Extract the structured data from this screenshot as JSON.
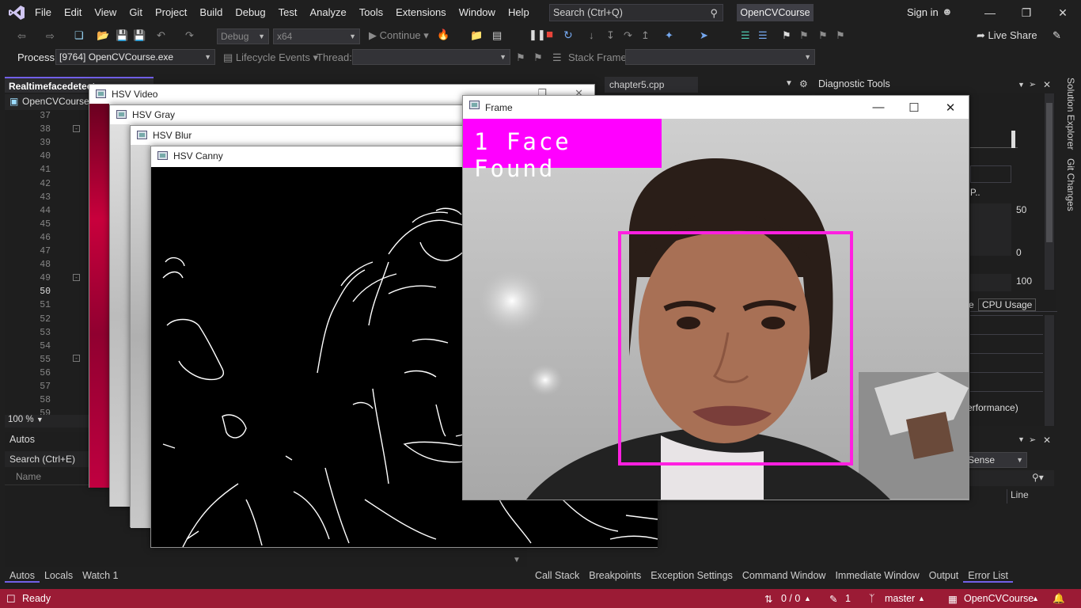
{
  "menubar": {
    "items": [
      "File",
      "Edit",
      "View",
      "Git",
      "Project",
      "Build",
      "Debug",
      "Test",
      "Analyze",
      "Tools",
      "Extensions",
      "Window",
      "Help"
    ],
    "search_placeholder": "Search (Ctrl+Q)",
    "solution_name": "OpenCVCourse",
    "sign_in": "Sign in"
  },
  "toolbar": {
    "config": "Debug",
    "platform": "x64",
    "continue_label": "Continue",
    "live_share": "Live Share"
  },
  "debug_location": {
    "process_label": "Process:",
    "process_value": "[9764] OpenCVCourse.exe",
    "lifecycle_label": "Lifecycle Events",
    "thread_label": "Thread:",
    "stack_frame_label": "Stack Frame:"
  },
  "editor": {
    "active_tab": "Realtimefacedetect",
    "other_tab": "chapter5.cpp",
    "nav_project": "OpenCVCourse",
    "line_numbers": [
      "37",
      "38",
      "39",
      "40",
      "41",
      "42",
      "43",
      "44",
      "45",
      "46",
      "47",
      "48",
      "49",
      "50",
      "51",
      "52",
      "53",
      "54",
      "55",
      "56",
      "57",
      "58",
      "59"
    ],
    "zoom": "100 %"
  },
  "autos": {
    "title": "Autos",
    "search_placeholder": "Search (Ctrl+E)",
    "col_name": "Name"
  },
  "bottom_tabs_left": [
    "Autos",
    "Locals",
    "Watch 1"
  ],
  "bottom_tabs_right": [
    "Call Stack",
    "Breakpoints",
    "Exception Settings",
    "Command Window",
    "Immediate Window",
    "Output",
    "Error List"
  ],
  "diagnostics": {
    "title": "Diagnostic Tools",
    "axis_top": "50",
    "axis_zero": "0",
    "axis_100": "100",
    "cpu_tab": "CPU Usage",
    "partial_p": "P..",
    "partial_perf": "erformance)",
    "partial_sense": "Sense",
    "line_col": "Line"
  },
  "side_rail": {
    "solution_explorer": "Solution Explorer",
    "git_changes": "Git Changes"
  },
  "statusbar": {
    "ready": "Ready",
    "sync": "0 / 0",
    "pending": "1",
    "branch": "master",
    "repo": "OpenCVCourse"
  },
  "cv_windows": {
    "hsv_video": "HSV Video",
    "hsv_gray": "HSV Gray",
    "hsv_blur": "HSV Blur",
    "hsv_canny": "HSV Canny",
    "frame": "Frame",
    "face_label": "1 Face Found"
  },
  "colors": {
    "status_bar": "#9b1b35",
    "face_box": "#ff20e0",
    "accent": "#7160e8"
  }
}
